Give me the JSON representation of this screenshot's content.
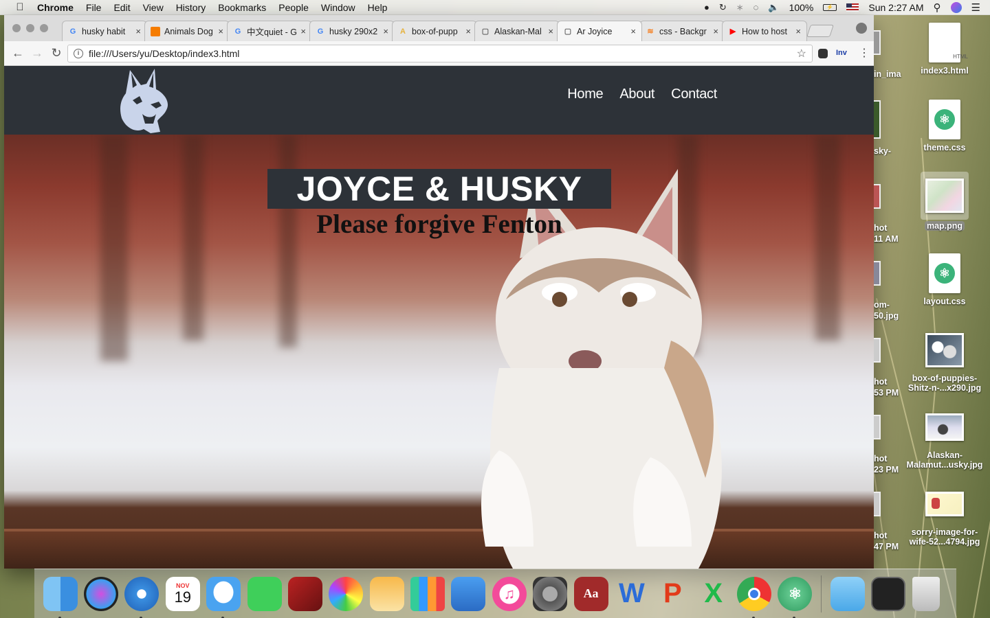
{
  "menubar": {
    "app_name": "Chrome",
    "menus": [
      "File",
      "Edit",
      "View",
      "History",
      "Bookmarks",
      "People",
      "Window",
      "Help"
    ],
    "battery": "100%",
    "clock": "Sun 2:27 AM"
  },
  "browser": {
    "tabs": [
      {
        "label": "husky habit",
        "favicon": "G",
        "fav_color": "#4285f4"
      },
      {
        "label": "Animals Dog",
        "favicon": "",
        "fav_color": "#f57c00"
      },
      {
        "label": "中文quiet - G",
        "favicon": "G",
        "fav_color": "#4285f4"
      },
      {
        "label": "husky 290x2",
        "favicon": "G",
        "fav_color": "#4285f4"
      },
      {
        "label": "box-of-pupp",
        "favicon": "A",
        "fav_color": "#e6b23c"
      },
      {
        "label": "Alaskan-Mal",
        "favicon": "▢",
        "fav_color": "#666666"
      },
      {
        "label": "Ar Joyice",
        "favicon": "▢",
        "fav_color": "#666666",
        "active": true
      },
      {
        "label": "css - Backgr",
        "favicon": "≋",
        "fav_color": "#f48024"
      },
      {
        "label": "How to host",
        "favicon": "▶",
        "fav_color": "#ff0000"
      }
    ],
    "url": "file:///Users/yu/Desktop/index3.html",
    "extension_label": "Inv"
  },
  "site": {
    "nav": [
      "Home",
      "About",
      "Contact"
    ],
    "title": "JOYCE & HUSKY",
    "subtitle": "Please forgive Fenton"
  },
  "desktop": {
    "icons": [
      {
        "label": "index3.html",
        "kind": "html",
        "doc_text": "HTML"
      },
      {
        "label": "theme.css",
        "kind": "atom"
      },
      {
        "label": "map.png",
        "kind": "map"
      },
      {
        "label": "layout.css",
        "kind": "atom"
      },
      {
        "label": "box-of-puppies-Shitz-n-...x290.jpg",
        "kind": "puppies"
      },
      {
        "label": "Alaskan-Malamut...usky.jpg",
        "kind": "alaskan"
      },
      {
        "label": "sorry-image-for-wife-52...4794.jpg",
        "kind": "sorry"
      }
    ],
    "left_fragments": [
      "in_ima",
      "sky-",
      "hot",
      "11 AM",
      "om-",
      "50.jpg",
      "hot",
      "53 PM",
      "hot",
      "23 PM",
      "hot",
      "47 PM"
    ]
  },
  "dock": {
    "apps": [
      "finder",
      "siri",
      "safari",
      "calendar",
      "messages",
      "facetime",
      "photo-booth",
      "photos",
      "pages",
      "numbers",
      "keynote",
      "itunes",
      "system-preferences",
      "dictionary",
      "word",
      "powerpoint",
      "excel",
      "chrome",
      "atom"
    ],
    "calendar_month": "NOV",
    "calendar_day": "19",
    "dictionary_text": "Aa"
  },
  "colors": {
    "site_header": "#2d3238",
    "title_box": "#2d3238"
  }
}
